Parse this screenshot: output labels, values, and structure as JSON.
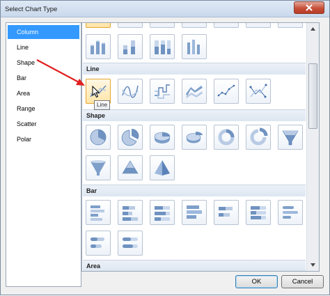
{
  "window": {
    "title": "Select Chart Type"
  },
  "chart_types": [
    "Column",
    "Line",
    "Shape",
    "Bar",
    "Area",
    "Range",
    "Scatter",
    "Polar"
  ],
  "selected_type": "Column",
  "sections": {
    "line": "Line",
    "shape": "Shape",
    "bar": "Bar",
    "area": "Area"
  },
  "tooltip": "Line",
  "buttons": {
    "ok": "OK",
    "cancel": "Cancel"
  },
  "colors": {
    "accent": "#3399ff",
    "annotation_arrow": "#e02020",
    "hover": "#ffe5a8"
  }
}
